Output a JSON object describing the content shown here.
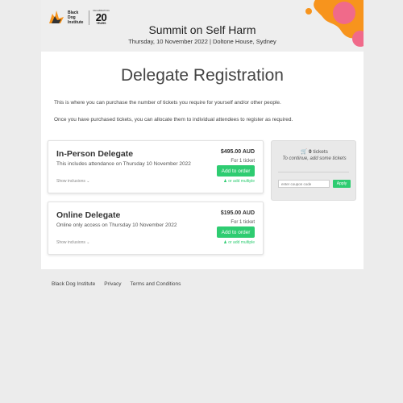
{
  "header": {
    "logo_text": "Black Dog Institute",
    "logo_anniv_top": "CELEBRATING",
    "logo_anniv_number": "20",
    "logo_anniv_bottom": "YEARS",
    "event_title": "Summit on Self Harm",
    "event_subtitle": "Thursday, 10 November 2022 | Doltone House, Sydney"
  },
  "main": {
    "title": "Delegate Registration",
    "intro_1": "This is where you can purchase the number of tickets you require for yourself and/or other people.",
    "intro_2": "Once you have purchased tickets, you can allocate them to individual attendees to register as required."
  },
  "tickets": [
    {
      "name": "In-Person Delegate",
      "description": "This includes attendance on Thursday 10 November 2022",
      "inclusions_label": "Show inclusions ⌄",
      "price": "$495.00 AUD",
      "per": "For 1 ticket",
      "button": "Add to order",
      "multiple": "or add multiple"
    },
    {
      "name": "Online Delegate",
      "description": "Online only access on Thursday 10 November 2022",
      "inclusions_label": "Show inclusions ⌄",
      "price": "$195.00 AUD",
      "per": "For 1 ticket",
      "button": "Add to order",
      "multiple": "or add multiple"
    }
  ],
  "cart": {
    "count": "0",
    "count_label": "tickets",
    "hint": "To continue, add some tickets",
    "coupon_placeholder": "enter coupon code",
    "apply_label": "Apply"
  },
  "footer": {
    "links": [
      "Black Dog Institute",
      "Privacy",
      "Terms and Conditions"
    ]
  },
  "colors": {
    "accent_green": "#2ecc71",
    "banner_orange": "#f7941d",
    "banner_pink": "#f06a8a"
  },
  "icons": {
    "cart": "cart-icon",
    "add_multiple": "users-icon",
    "logo": "dog-logo-icon"
  }
}
